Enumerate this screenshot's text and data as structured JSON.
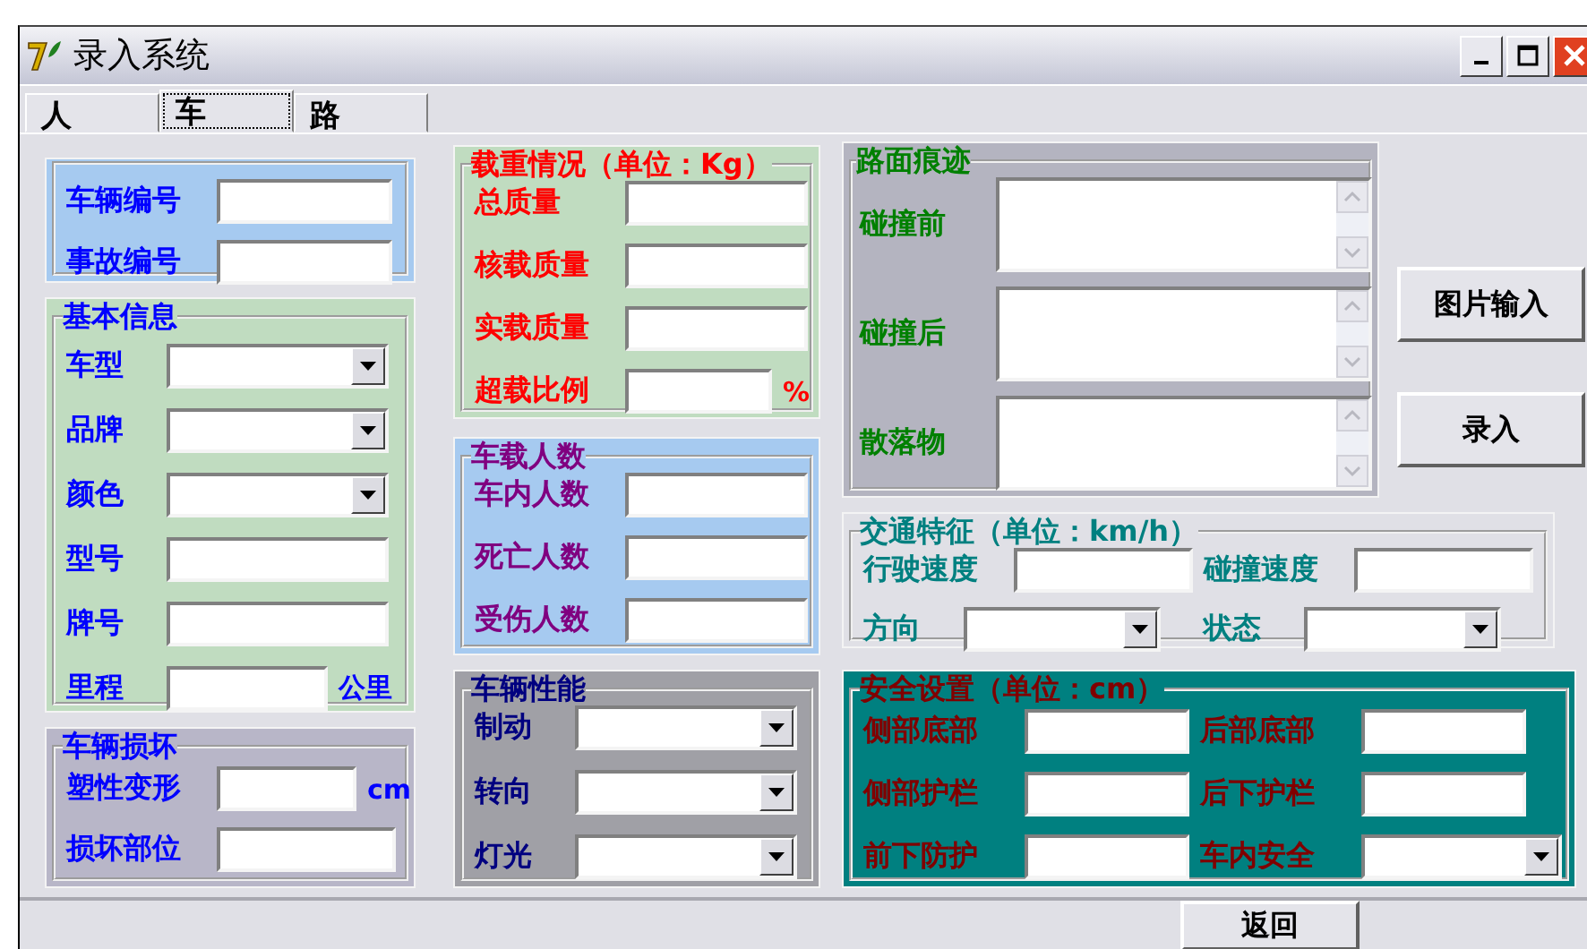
{
  "window": {
    "title": "录入系统"
  },
  "tabs": [
    {
      "label": "人",
      "selected": false
    },
    {
      "label": "车",
      "selected": true
    },
    {
      "label": "路",
      "selected": false
    }
  ],
  "vehicle_ids": {
    "fields": [
      {
        "label": "车辆编号",
        "kind": "text"
      },
      {
        "label": "事故编号",
        "kind": "text"
      }
    ]
  },
  "basic_info": {
    "title": "基本信息",
    "fields": [
      {
        "label": "车型",
        "kind": "dropdown"
      },
      {
        "label": "品牌",
        "kind": "dropdown"
      },
      {
        "label": "颜色",
        "kind": "dropdown"
      },
      {
        "label": "型号",
        "kind": "text"
      },
      {
        "label": "牌号",
        "kind": "text"
      },
      {
        "label": "里程",
        "kind": "text",
        "unit": "公里"
      }
    ]
  },
  "damage": {
    "title": "车辆损坏",
    "fields": [
      {
        "label": "塑性变形",
        "kind": "text",
        "unit": "cm"
      },
      {
        "label": "损坏部位",
        "kind": "text"
      }
    ]
  },
  "load": {
    "title": "载重情况（单位：Kg）",
    "fields": [
      {
        "label": "总质量",
        "kind": "text"
      },
      {
        "label": "核载质量",
        "kind": "text"
      },
      {
        "label": "实载质量",
        "kind": "text"
      },
      {
        "label": "超载比例",
        "kind": "text",
        "unit": "%"
      }
    ]
  },
  "occupants": {
    "title": "车载人数",
    "fields": [
      {
        "label": "车内人数",
        "kind": "text"
      },
      {
        "label": "死亡人数",
        "kind": "text"
      },
      {
        "label": "受伤人数",
        "kind": "text"
      }
    ]
  },
  "performance": {
    "title": "车辆性能",
    "fields": [
      {
        "label": "制动",
        "kind": "dropdown"
      },
      {
        "label": "转向",
        "kind": "dropdown"
      },
      {
        "label": "灯光",
        "kind": "dropdown"
      }
    ]
  },
  "road_marks": {
    "title": "路面痕迹",
    "fields": [
      {
        "label": "碰撞前",
        "kind": "memo"
      },
      {
        "label": "碰撞后",
        "kind": "memo"
      },
      {
        "label": "散落物",
        "kind": "memo"
      }
    ]
  },
  "side_buttons": [
    "图片输入",
    "录入"
  ],
  "traffic": {
    "title": "交通特征（单位：km/h）",
    "fields": [
      {
        "label": "行驶速度",
        "kind": "text"
      },
      {
        "label": "碰撞速度",
        "kind": "text"
      },
      {
        "label": "方向",
        "kind": "dropdown"
      },
      {
        "label": "状态",
        "kind": "dropdown"
      }
    ]
  },
  "safety": {
    "title": "安全设置（单位：cm）",
    "fields": [
      {
        "label": "侧部底部",
        "kind": "text"
      },
      {
        "label": "后部底部",
        "kind": "text"
      },
      {
        "label": "侧部护栏",
        "kind": "text"
      },
      {
        "label": "后下护栏",
        "kind": "text"
      },
      {
        "label": "前下防护",
        "kind": "text"
      },
      {
        "label": "车内安全",
        "kind": "dropdown"
      }
    ]
  },
  "footer_button": "返回"
}
